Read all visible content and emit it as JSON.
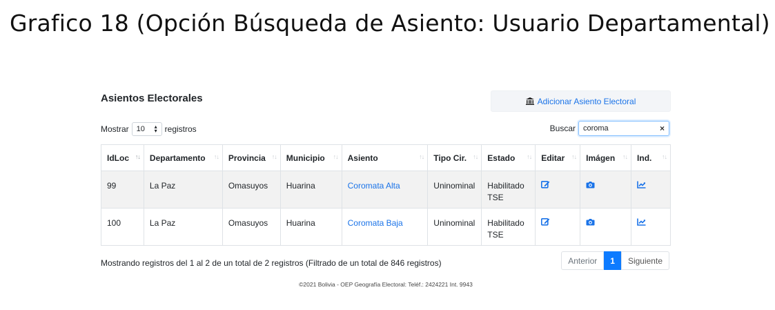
{
  "caption": "Grafico 18 (Opción Búsqueda de Asiento: Usuario Departamental)",
  "page": {
    "title": "Asientos Electorales",
    "add_button_label": "Adicionar Asiento Electoral",
    "add_button_icon": "institution-icon"
  },
  "length": {
    "prefix": "Mostrar",
    "value": "10",
    "suffix": "registros"
  },
  "search": {
    "label": "Buscar",
    "value": "coroma",
    "clear": "×"
  },
  "table": {
    "headers": [
      "IdLoc",
      "Departamento",
      "Provincia",
      "Municipio",
      "Asiento",
      "Tipo Cir.",
      "Estado",
      "Editar",
      "Imágen",
      "Ind."
    ],
    "rows": [
      {
        "idloc": "99",
        "departamento": "La Paz",
        "provincia": "Omasuyos",
        "municipio": "Huarina",
        "asiento": "Coromata Alta",
        "tipo": "Uninominal",
        "estado_1": "Habilitado",
        "estado_2": "TSE"
      },
      {
        "idloc": "100",
        "departamento": "La Paz",
        "provincia": "Omasuyos",
        "municipio": "Huarina",
        "asiento": "Coromata Baja",
        "tipo": "Uninominal",
        "estado_1": "Habilitado",
        "estado_2": "TSE"
      }
    ],
    "row_icons": {
      "edit": "edit-icon",
      "image": "camera-icon",
      "indicator": "chart-line-icon"
    }
  },
  "info": "Mostrando registros del 1 al 2 de un total de 2 registros (Filtrado de un total de 846 registros)",
  "pagination": {
    "prev": "Anterior",
    "current": "1",
    "next": "Siguiente"
  },
  "footer": "©2021 Bolivia - OEP Geografía Electoral: Teléf.: 2424221 Int. 9943",
  "colors": {
    "link": "#1a73e8",
    "active_page": "#0d7bff",
    "stripe": "#f2f2f2"
  }
}
